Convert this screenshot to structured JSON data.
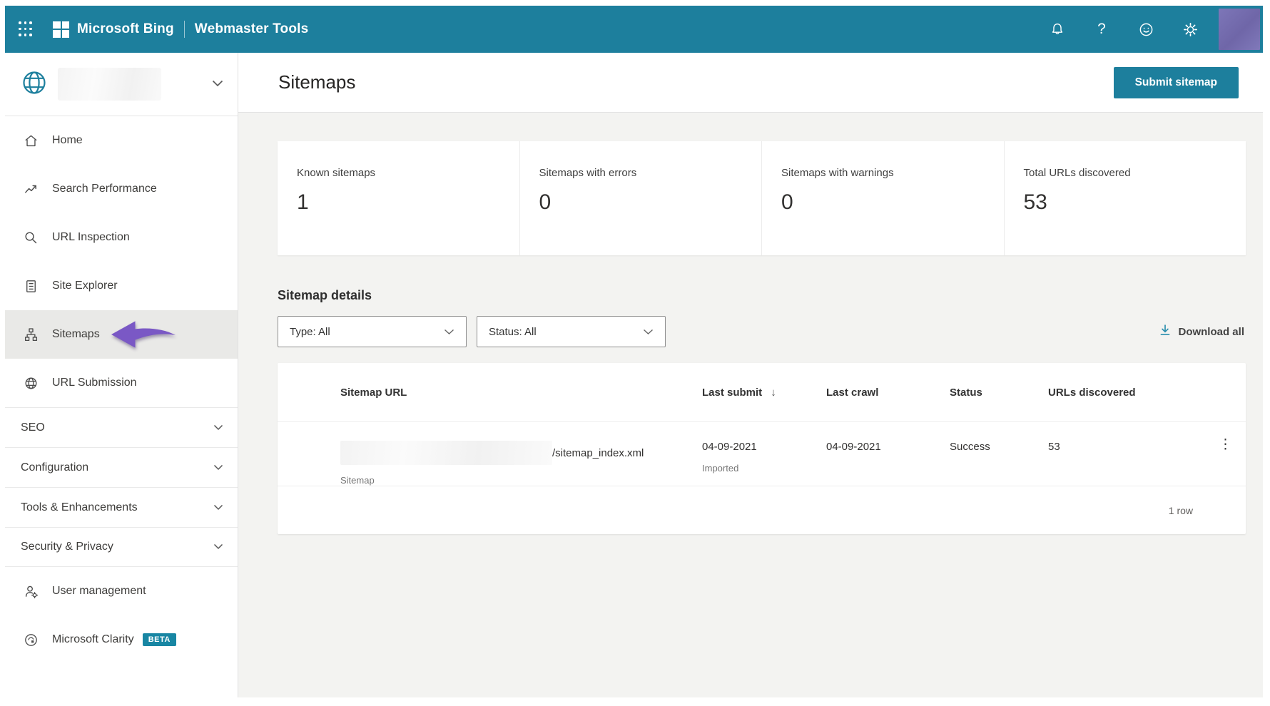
{
  "header": {
    "brand": "Microsoft Bing",
    "product": "Webmaster Tools",
    "help_label": "?"
  },
  "sidebar": {
    "items": [
      {
        "label": "Home",
        "icon": "home-icon"
      },
      {
        "label": "Search Performance",
        "icon": "trend-icon"
      },
      {
        "label": "URL Inspection",
        "icon": "magnifier-icon"
      },
      {
        "label": "Site Explorer",
        "icon": "document-icon"
      },
      {
        "label": "Sitemaps",
        "icon": "sitemap-icon",
        "selected": true
      },
      {
        "label": "URL Submission",
        "icon": "globe-icon"
      }
    ],
    "groups": [
      {
        "label": "SEO"
      },
      {
        "label": "Configuration"
      },
      {
        "label": "Tools & Enhancements"
      },
      {
        "label": "Security & Privacy"
      }
    ],
    "footer_items": [
      {
        "label": "User management",
        "icon": "user-gear-icon"
      },
      {
        "label": "Microsoft Clarity",
        "icon": "clarity-icon",
        "badge": "BETA"
      }
    ]
  },
  "page": {
    "title": "Sitemaps",
    "submit_button": "Submit sitemap"
  },
  "stats": [
    {
      "label": "Known sitemaps",
      "value": "1"
    },
    {
      "label": "Sitemaps with errors",
      "value": "0"
    },
    {
      "label": "Sitemaps with warnings",
      "value": "0"
    },
    {
      "label": "Total URLs discovered",
      "value": "53"
    }
  ],
  "details": {
    "heading": "Sitemap details",
    "type_filter": "Type: All",
    "status_filter": "Status: All",
    "download_all": "Download all"
  },
  "table": {
    "columns": {
      "url": "Sitemap URL",
      "last_submit": "Last submit",
      "last_crawl": "Last crawl",
      "status": "Status",
      "urls_discovered": "URLs discovered"
    },
    "row": {
      "url_visible": "/sitemap_index.xml",
      "type": "Sitemap",
      "last_submit": "04-09-2021",
      "last_submit_note": "Imported",
      "last_crawl": "04-09-2021",
      "status": "Success",
      "urls_discovered": "53"
    },
    "footer": "1 row",
    "kebab": "⋮",
    "sort_arrow": "↓"
  },
  "colors": {
    "accent": "#1d7f9d",
    "arrow_purple": "#7a58c5",
    "beta_badge": "#1886a3",
    "background": "#f3f3f1"
  }
}
